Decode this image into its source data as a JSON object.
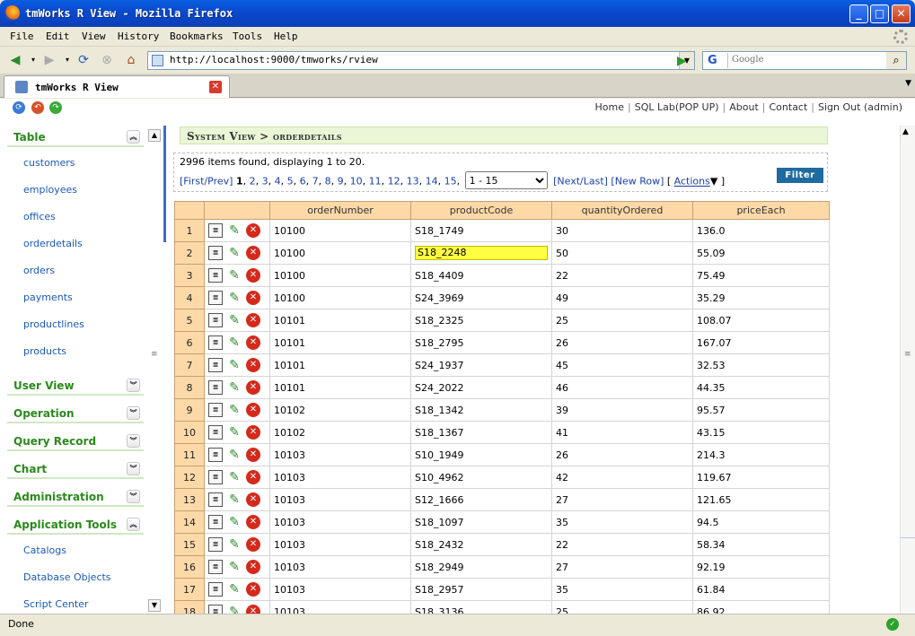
{
  "window": {
    "title": "tmWorks R View - Mozilla Firefox"
  },
  "menu": [
    "File",
    "Edit",
    "View",
    "History",
    "Bookmarks",
    "Tools",
    "Help"
  ],
  "nav": {
    "url": "http://localhost:9000/tmworks/rview",
    "search_placeholder": "Google",
    "search_engine_label": "G"
  },
  "tab": {
    "label": "tmWorks R View"
  },
  "toplinks": [
    "Home",
    "SQL Lab(POP UP)",
    "About",
    "Contact",
    "Sign Out (admin)"
  ],
  "sidebar": {
    "table_label": "Table",
    "table_items": [
      "customers",
      "employees",
      "offices",
      "orderdetails",
      "orders",
      "payments",
      "productlines",
      "products"
    ],
    "sections": [
      "User View",
      "Operation",
      "Query Record",
      "Chart",
      "Administration"
    ],
    "apptools_label": "Application Tools",
    "apptools_items": [
      "Catalogs",
      "Database Objects",
      "Script Center"
    ]
  },
  "breadcrumb": "System View > orderdetails",
  "info": {
    "found_text": "2996 items found, displaying 1 to 20.",
    "first_prev": "[First/Prev]",
    "current_page": "1",
    "pages": [
      "2",
      "3",
      "4",
      "5",
      "6",
      "7",
      "8",
      "9",
      "10",
      "11",
      "12",
      "13",
      "14",
      "15"
    ],
    "page_range": "1 - 15",
    "next_last": "[Next/Last]",
    "new_row": "[New Row]",
    "actions": "Actions",
    "filter": "Filter"
  },
  "grid": {
    "columns": [
      "orderNumber",
      "productCode",
      "quantityOrdered",
      "priceEach"
    ],
    "highlight_row": 2,
    "rows": [
      [
        "1",
        "10100",
        "S18_1749",
        "30",
        "136.0"
      ],
      [
        "2",
        "10100",
        "S18_2248",
        "50",
        "55.09"
      ],
      [
        "3",
        "10100",
        "S18_4409",
        "22",
        "75.49"
      ],
      [
        "4",
        "10100",
        "S24_3969",
        "49",
        "35.29"
      ],
      [
        "5",
        "10101",
        "S18_2325",
        "25",
        "108.07"
      ],
      [
        "6",
        "10101",
        "S18_2795",
        "26",
        "167.07"
      ],
      [
        "7",
        "10101",
        "S24_1937",
        "45",
        "32.53"
      ],
      [
        "8",
        "10101",
        "S24_2022",
        "46",
        "44.35"
      ],
      [
        "9",
        "10102",
        "S18_1342",
        "39",
        "95.57"
      ],
      [
        "10",
        "10102",
        "S18_1367",
        "41",
        "43.15"
      ],
      [
        "11",
        "10103",
        "S10_1949",
        "26",
        "214.3"
      ],
      [
        "12",
        "10103",
        "S10_4962",
        "42",
        "119.67"
      ],
      [
        "13",
        "10103",
        "S12_1666",
        "27",
        "121.65"
      ],
      [
        "14",
        "10103",
        "S18_1097",
        "35",
        "94.5"
      ],
      [
        "15",
        "10103",
        "S18_2432",
        "22",
        "58.34"
      ],
      [
        "16",
        "10103",
        "S18_2949",
        "27",
        "92.19"
      ],
      [
        "17",
        "10103",
        "S18_2957",
        "35",
        "61.84"
      ],
      [
        "18",
        "10103",
        "S18_3136",
        "25",
        "86.92"
      ]
    ]
  },
  "status": {
    "text": "Done"
  },
  "colors": {
    "accent": "#2b8a1c",
    "grid_header": "#fdd9a8",
    "highlight": "#fffe40",
    "filter_button": "#1f6aa0"
  }
}
